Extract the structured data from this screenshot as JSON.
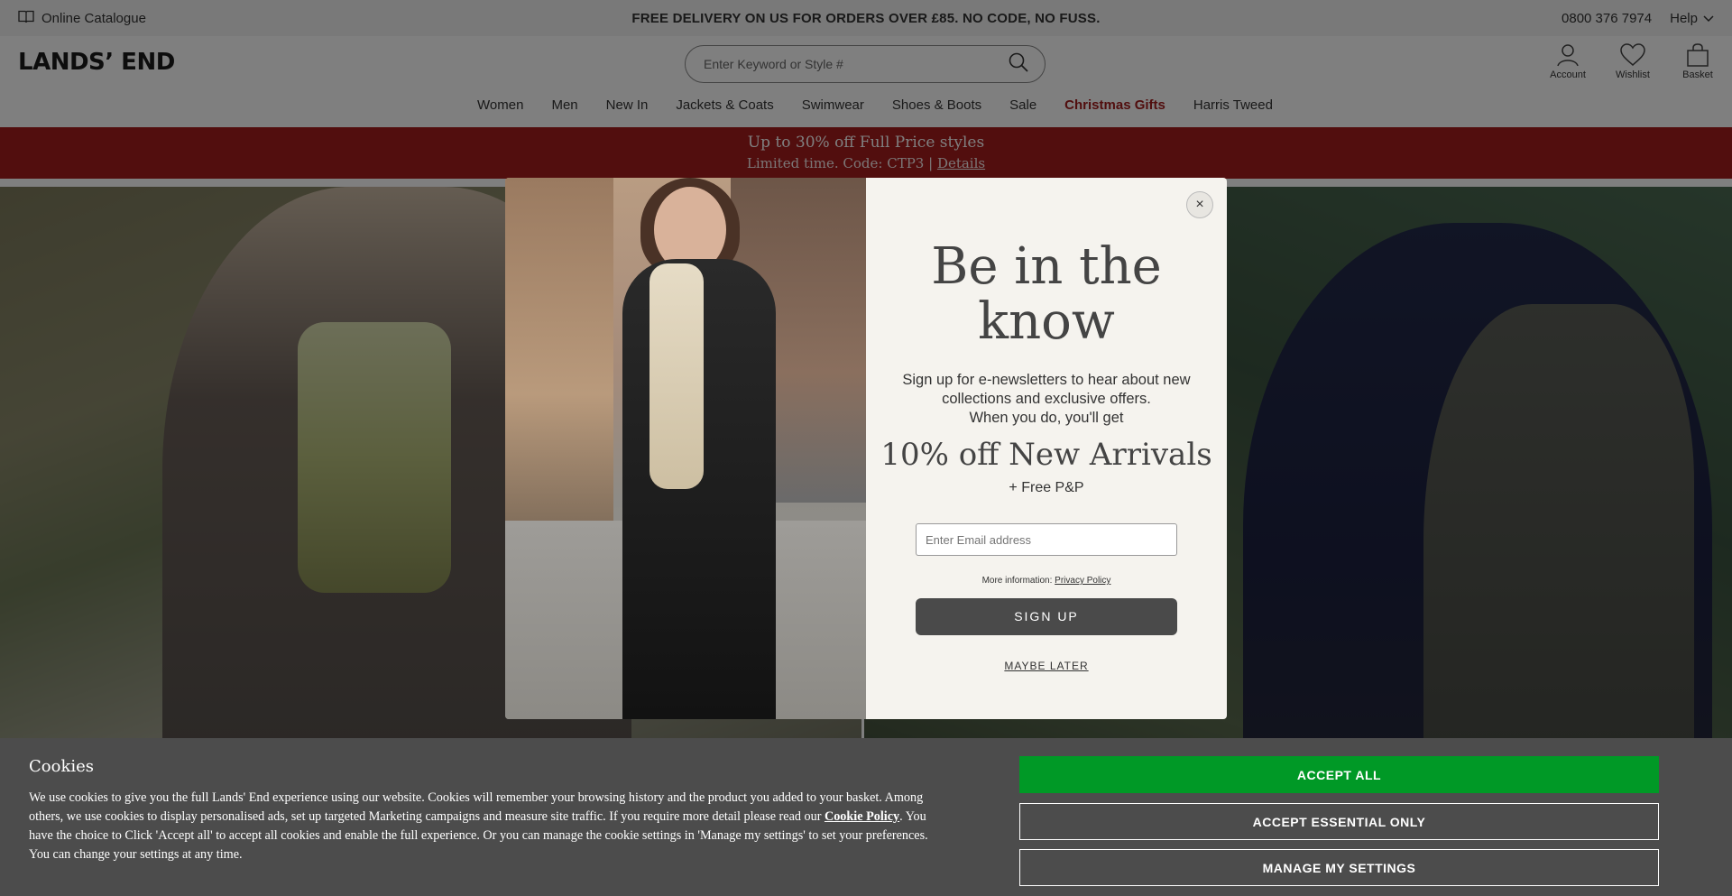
{
  "utility_bar": {
    "catalogue_label": "Online Catalogue",
    "delivery_message": "FREE DELIVERY ON US FOR ORDERS OVER £85. NO CODE, NO FUSS.",
    "phone": "0800 376 7974",
    "help_label": "Help"
  },
  "header": {
    "logo": "LANDS’ END",
    "search_placeholder": "Enter Keyword or Style #",
    "account_label": "Account",
    "wishlist_label": "Wishlist",
    "basket_label": "Basket"
  },
  "nav": {
    "items": [
      {
        "label": "Women"
      },
      {
        "label": "Men"
      },
      {
        "label": "New In"
      },
      {
        "label": "Jackets & Coats"
      },
      {
        "label": "Swimwear"
      },
      {
        "label": "Shoes & Boots"
      },
      {
        "label": "Sale"
      },
      {
        "label": "Christmas Gifts"
      },
      {
        "label": "Harris Tweed"
      }
    ]
  },
  "promo": {
    "title": "Up to 30% off Full Price styles",
    "subtitle": "Limited time. Code: CTP3 |",
    "details_label": "Details"
  },
  "modal": {
    "heading": "Be in the know",
    "body_line1": "Sign up for e-newsletters to hear about new collections and exclusive offers.",
    "body_line2": "When you do, you'll get",
    "offer": "10% off New Arrivals",
    "free_pp": "+ Free P&P",
    "email_placeholder": "Enter Email address",
    "more_info": "More information:",
    "privacy_label": "Privacy Policy",
    "signup_label": "SIGN UP",
    "maybe_later_label": "MAYBE LATER",
    "close_glyph": "×"
  },
  "cookies": {
    "title": "Cookies",
    "text_part1": "We use cookies to give you the full Lands' End experience using our website. Cookies will remember your browsing history and the product you added to your basket. Among others, we use cookies to display personalised ads, set up targeted Marketing campaigns and measure site traffic. If you require more detail please read our ",
    "policy_link": "Cookie Policy",
    "text_part2": ". You have the choice to Click 'Accept all' to accept all cookies and enable the full experience. Or you can manage the cookie settings in 'Manage my settings' to set your preferences. You can change your settings at any time.",
    "accept_all_label": "ACCEPT ALL",
    "accept_essential_label": "ACCEPT ESSENTIAL ONLY",
    "manage_label": "MANAGE MY SETTINGS"
  },
  "colors": {
    "promo_red": "#a41c1c",
    "accept_green": "#009926",
    "cookie_bg": "#4c4c4c",
    "modal_bg": "#f5f3ee",
    "signup_bg": "#4a4a4a"
  }
}
